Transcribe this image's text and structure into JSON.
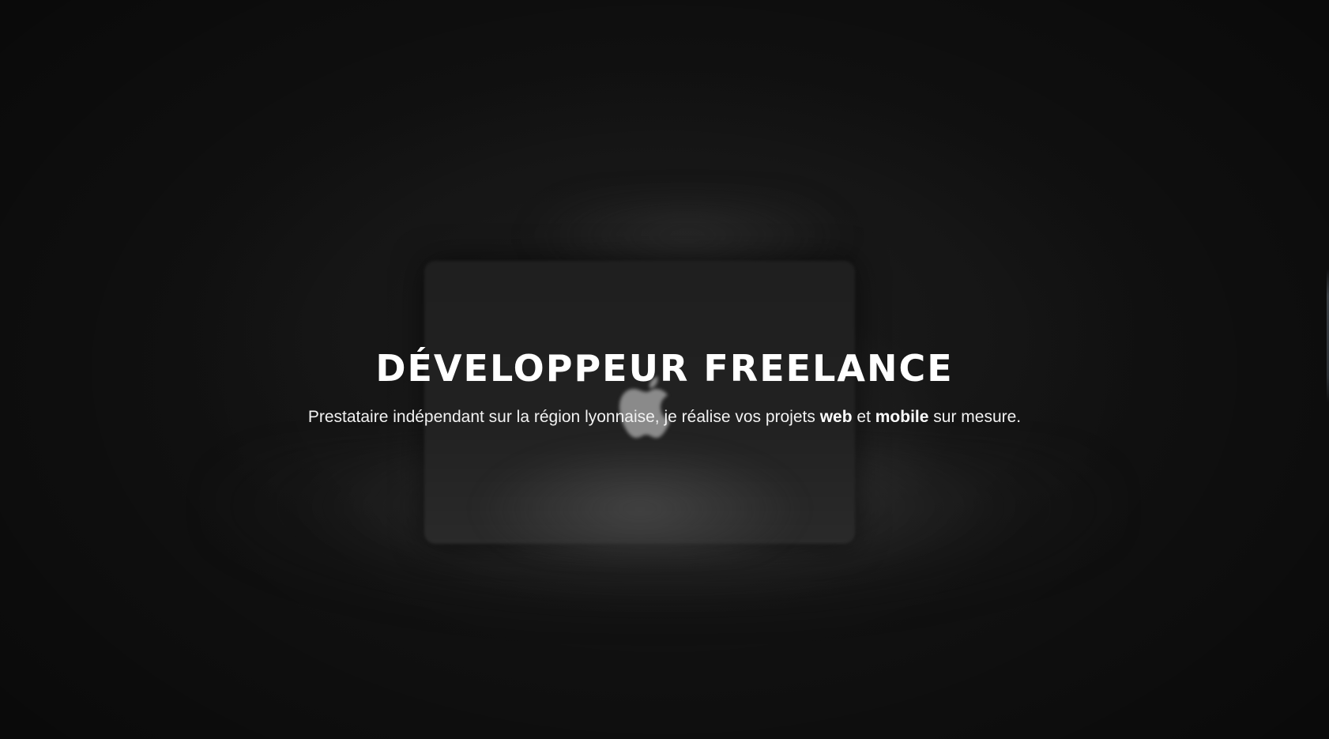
{
  "hero": {
    "title": "DÉVELOPPEUR FREELANCE",
    "subtitle": {
      "part1": "Prestataire indépendant sur la région lyonnaise, je réalise vos projets ",
      "emphasis1": "web",
      "part2": " et ",
      "emphasis2": "mobile",
      "part3": " sur mesure."
    },
    "background_image": "apple-laptop-on-bed-dark-photo"
  },
  "colors": {
    "background": "#141414",
    "text": "#ffffff"
  }
}
